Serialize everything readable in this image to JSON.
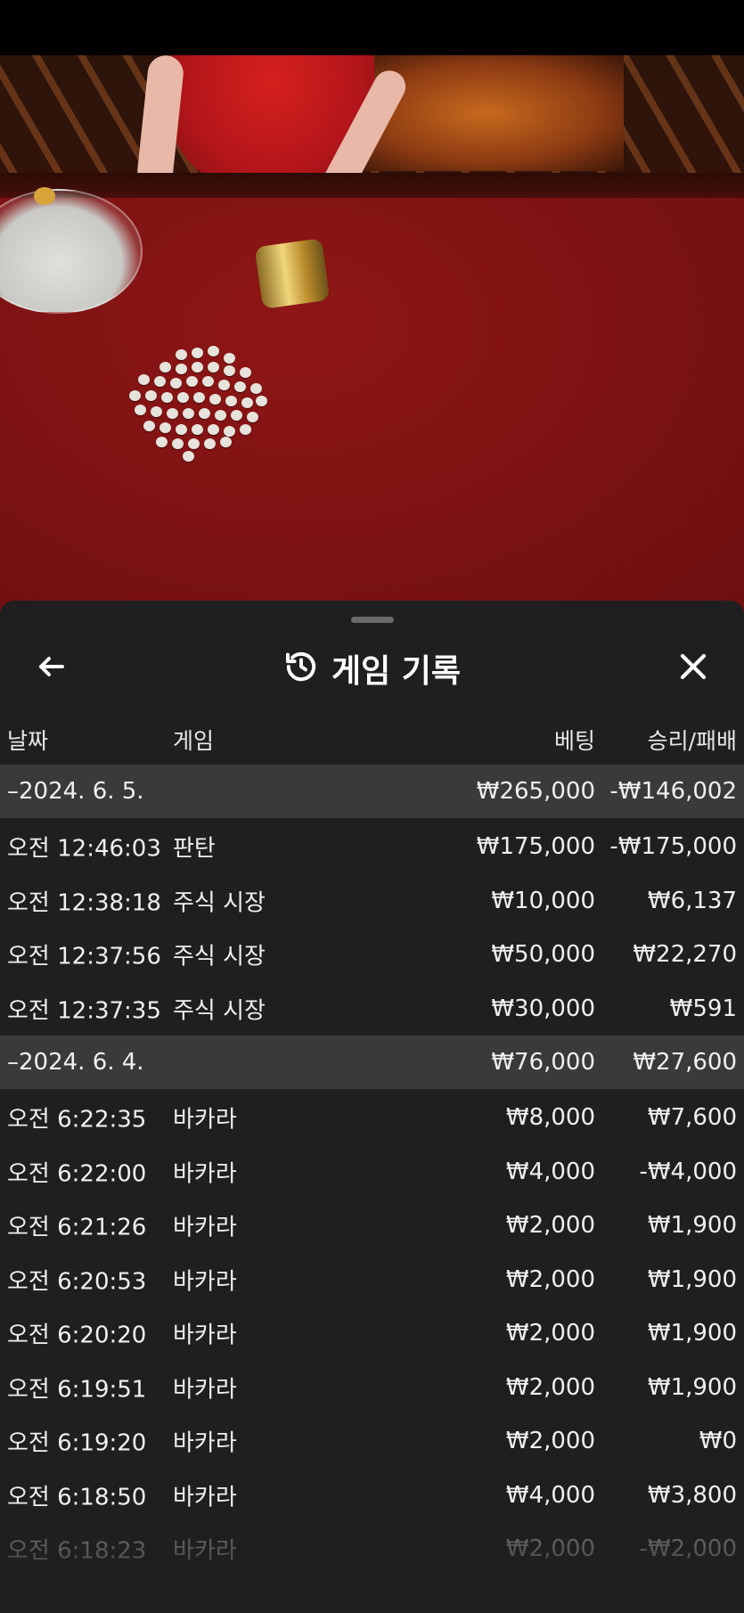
{
  "header": {
    "title": "게임 기록",
    "back_icon": "arrow-left-icon",
    "history_icon": "history-icon",
    "close_icon": "close-icon"
  },
  "columns": {
    "date": "날짜",
    "game": "게임",
    "bet": "베팅",
    "result": "승리/패배"
  },
  "groups": [
    {
      "date": "–2024. 6. 5.",
      "bet_total": "₩265,000",
      "result_total": "-₩146,002",
      "rows": [
        {
          "time": "오전 12:46:03",
          "game": "판탄",
          "bet": "₩175,000",
          "result": "-₩175,000"
        },
        {
          "time": "오전 12:38:18",
          "game": "주식 시장",
          "bet": "₩10,000",
          "result": "₩6,137"
        },
        {
          "time": "오전 12:37:56",
          "game": "주식 시장",
          "bet": "₩50,000",
          "result": "₩22,270"
        },
        {
          "time": "오전 12:37:35",
          "game": "주식 시장",
          "bet": "₩30,000",
          "result": "₩591"
        }
      ]
    },
    {
      "date": "–2024. 6. 4.",
      "bet_total": "₩76,000",
      "result_total": "₩27,600",
      "rows": [
        {
          "time": "오전 6:22:35",
          "game": "바카라",
          "bet": "₩8,000",
          "result": "₩7,600"
        },
        {
          "time": "오전 6:22:00",
          "game": "바카라",
          "bet": "₩4,000",
          "result": "-₩4,000"
        },
        {
          "time": "오전 6:21:26",
          "game": "바카라",
          "bet": "₩2,000",
          "result": "₩1,900"
        },
        {
          "time": "오전 6:20:53",
          "game": "바카라",
          "bet": "₩2,000",
          "result": "₩1,900"
        },
        {
          "time": "오전 6:20:20",
          "game": "바카라",
          "bet": "₩2,000",
          "result": "₩1,900"
        },
        {
          "time": "오전 6:19:51",
          "game": "바카라",
          "bet": "₩2,000",
          "result": "₩1,900"
        },
        {
          "time": "오전 6:19:20",
          "game": "바카라",
          "bet": "₩2,000",
          "result": "₩0"
        },
        {
          "time": "오전 6:18:50",
          "game": "바카라",
          "bet": "₩4,000",
          "result": "₩3,800"
        },
        {
          "time": "오전 6:18:23",
          "game": "바카라",
          "bet": "₩2,000",
          "result": "-₩2,000"
        }
      ]
    }
  ]
}
